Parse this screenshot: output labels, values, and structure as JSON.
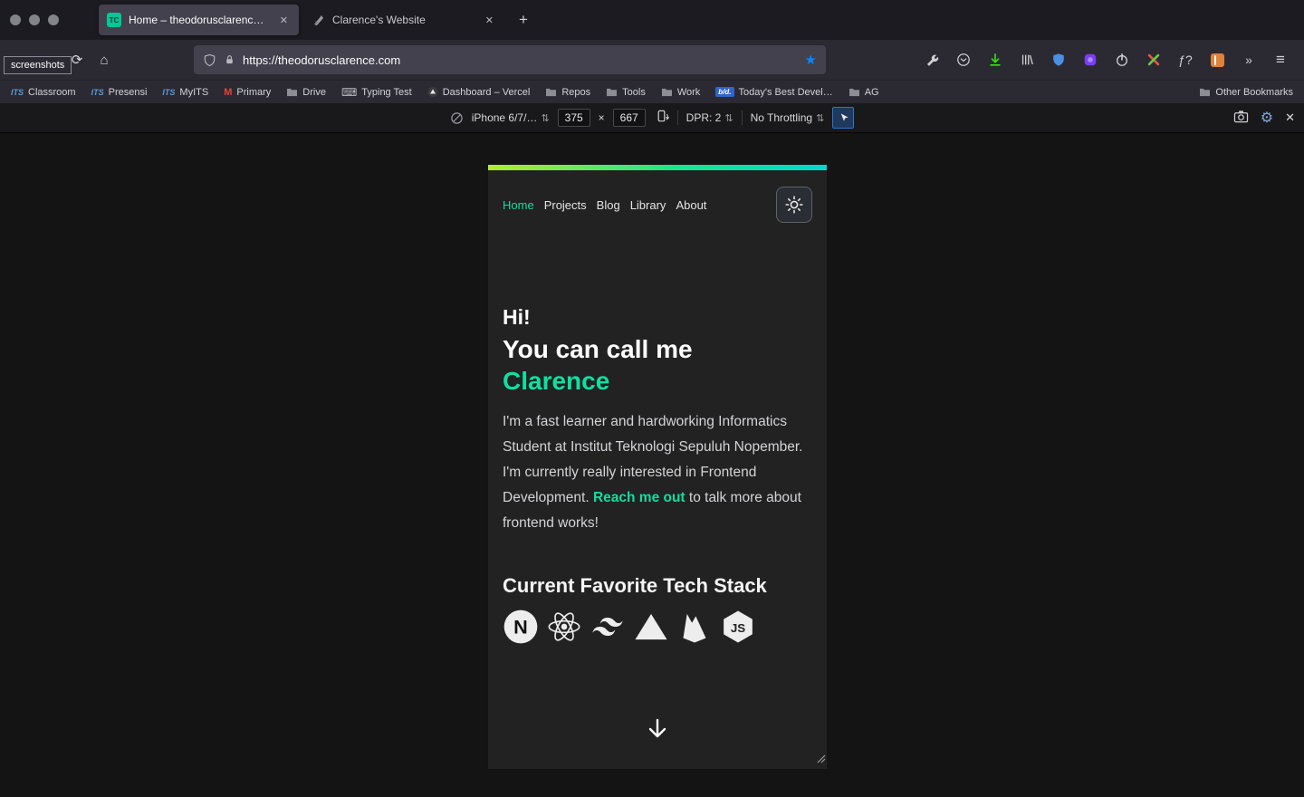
{
  "colors": {
    "accent": "#10dfa0",
    "gradient_left": "#b4ec2b",
    "gradient_right": "#00d9c5",
    "download_green": "#30e60b",
    "star_blue": "#0a84ff"
  },
  "glyphs": {
    "close_tab": "✕",
    "new_tab": "+",
    "back": "←",
    "forward": "→",
    "reload": "⟳",
    "home": "⌂",
    "star": "★",
    "fn": "ƒ?",
    "chevrons": "»",
    "menu": "≡",
    "stepper": "⇅",
    "gear": "⚙",
    "close": "✕"
  },
  "titlebar": {
    "tabs": [
      {
        "favicon_text": "TC",
        "title": "Home – theodorusclarence.com"
      },
      {
        "title": "Clarence's Website"
      }
    ]
  },
  "tooltip": {
    "text": "screenshots"
  },
  "navbar": {
    "url": "https://theodorusclarence.com"
  },
  "icon_text": {
    "its": "ITS",
    "gmail": "M",
    "bfd": "b/d."
  },
  "bookmarks": {
    "items": [
      {
        "icon": "its",
        "label": "Classroom"
      },
      {
        "icon": "its",
        "label": "Presensi"
      },
      {
        "icon": "its",
        "label": "MyITS"
      },
      {
        "icon": "gmail",
        "label": "Primary"
      },
      {
        "icon": "folder",
        "label": "Drive"
      },
      {
        "icon": "keyboard",
        "label": "Typing Test"
      },
      {
        "icon": "vercel",
        "label": "Dashboard – Vercel"
      },
      {
        "icon": "folder",
        "label": "Repos"
      },
      {
        "icon": "folder",
        "label": "Tools"
      },
      {
        "icon": "folder",
        "label": "Work"
      },
      {
        "icon": "bfd",
        "label": "Today's Best Devel…"
      },
      {
        "icon": "folder",
        "label": "AG"
      }
    ],
    "other": "Other Bookmarks"
  },
  "rdm": {
    "device": "iPhone 6/7/…",
    "width": "375",
    "times": "×",
    "height": "667",
    "dpr": "DPR: 2",
    "throttling": "No Throttling"
  },
  "site": {
    "nav": [
      "Home",
      "Projects",
      "Blog",
      "Library",
      "About"
    ],
    "hero": {
      "line1": "Hi!",
      "line2": "You can call me",
      "line3": "Clarence"
    },
    "intro": {
      "before": "I'm a fast learner and hardworking Informatics Student at Institut Teknologi Sepuluh Nopember. I'm currently really interested in Frontend Development. ",
      "link": "Reach me out",
      "after": " to talk more about frontend works!"
    },
    "tech": {
      "heading": "Current Favorite Tech Stack",
      "icons": [
        "nextjs",
        "react",
        "tailwindcss",
        "vercel",
        "firebase",
        "nodejs"
      ]
    }
  }
}
